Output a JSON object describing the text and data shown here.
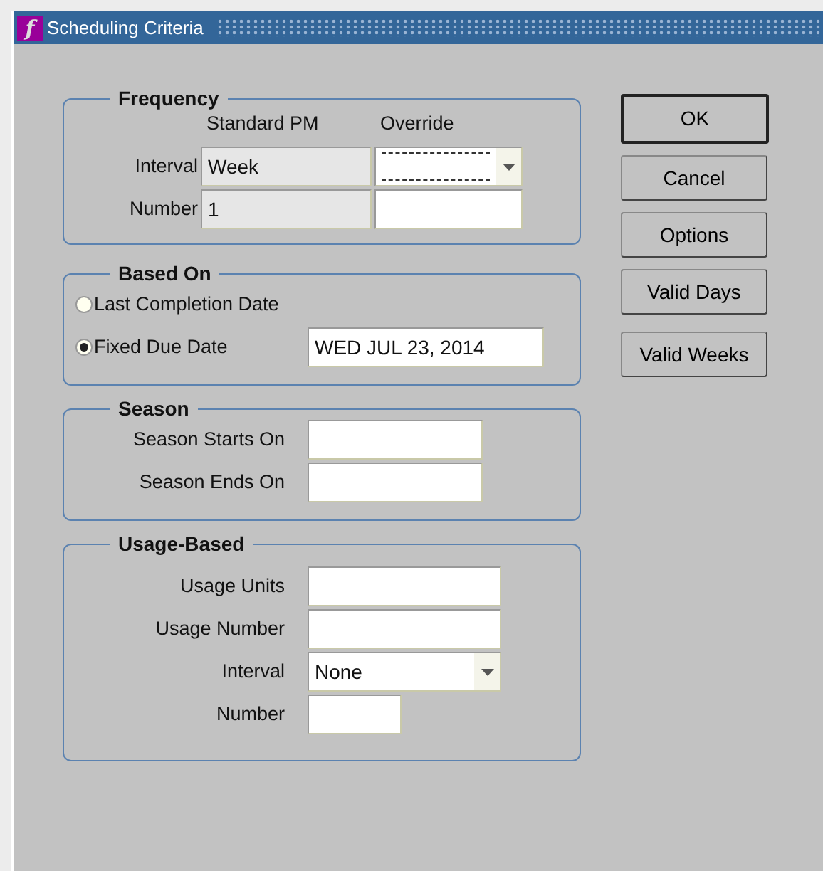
{
  "window": {
    "title": "Scheduling Criteria",
    "icon": "f"
  },
  "frequency": {
    "title": "Frequency",
    "columns": [
      "Standard PM",
      "Override"
    ],
    "rows": [
      {
        "label": "Interval",
        "standard_pm": "Week",
        "kind": "dropdown",
        "focused": true
      },
      {
        "label": "Number",
        "standard_pm": "1",
        "kind": "text",
        "focused": false
      }
    ]
  },
  "based_on": {
    "title": "Based On",
    "options": [
      {
        "label": "Last Completion Date",
        "selected": false
      },
      {
        "label": "Fixed Due Date",
        "selected": true,
        "value": "WED JUL 23, 2014"
      }
    ]
  },
  "season": {
    "title": "Season",
    "fields": [
      {
        "label": "Season Starts On"
      },
      {
        "label": "Season Ends On"
      }
    ]
  },
  "usage": {
    "title": "Usage-Based",
    "fields": [
      {
        "label": "Usage Units",
        "kind": "text"
      },
      {
        "label": "Usage Number",
        "kind": "text"
      },
      {
        "label": "Interval",
        "kind": "dropdown",
        "value": "None"
      },
      {
        "label": "Number",
        "kind": "short"
      }
    ]
  },
  "buttons": [
    {
      "label": "OK",
      "default": true
    },
    {
      "label": "Cancel",
      "default": false
    },
    {
      "label": "Options",
      "default": false
    },
    {
      "label": "Valid Days",
      "default": false
    },
    {
      "label": "Valid Weeks",
      "default": false
    }
  ]
}
